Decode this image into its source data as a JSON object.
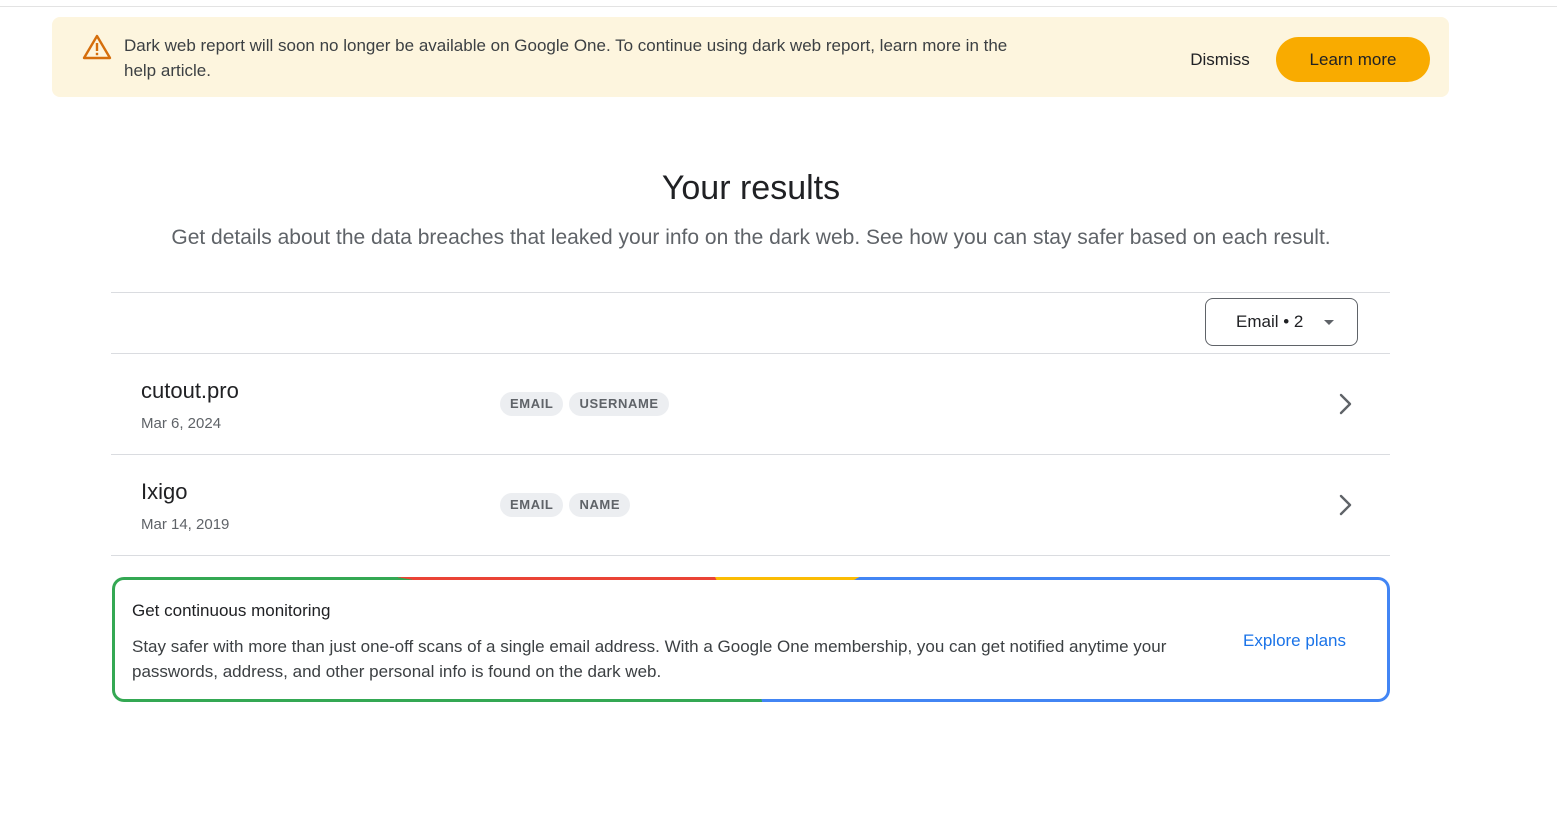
{
  "banner": {
    "message": "Dark web report will soon no longer be available on Google One. To continue using dark web report, learn more in the help article.",
    "dismiss_label": "Dismiss",
    "learn_more_label": "Learn more",
    "icon": "warning-icon",
    "accent_color": "#f9ab00",
    "background_color": "#fdf5de"
  },
  "header": {
    "title": "Your results",
    "subtitle": "Get details about the data breaches that leaked your info on the dark web. See how you can stay safer based on each result."
  },
  "filter": {
    "label": "Email • 2"
  },
  "results": [
    {
      "site": "cutout.pro",
      "date": "Mar 6, 2024",
      "tags": [
        "EMAIL",
        "USERNAME"
      ]
    },
    {
      "site": "Ixigo",
      "date": "Mar 14, 2019",
      "tags": [
        "EMAIL",
        "NAME"
      ]
    }
  ],
  "monitoring": {
    "title": "Get continuous monitoring",
    "text": "Stay safer with more than just one-off scans of a single email address. With a Google One membership, you can get notified anytime your passwords, address, and other personal info is found on the dark web.",
    "link_label": "Explore plans",
    "link_color": "#1a73e8"
  }
}
